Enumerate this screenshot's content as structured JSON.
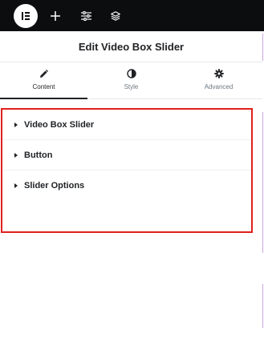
{
  "toolbar": {
    "logo_icon": "elementor-logo-icon",
    "buttons": [
      {
        "name": "add-element-button",
        "icon": "plus-icon"
      },
      {
        "name": "site-settings-button",
        "icon": "sliders-icon"
      },
      {
        "name": "structure-button",
        "icon": "layers-icon"
      }
    ]
  },
  "header": {
    "title": "Edit Video Box Slider"
  },
  "tabs": [
    {
      "label": "Content",
      "icon": "pencil-icon",
      "active": true
    },
    {
      "label": "Style",
      "icon": "half-circle-icon",
      "active": false
    },
    {
      "label": "Advanced",
      "icon": "gear-icon",
      "active": false
    }
  ],
  "sections": [
    {
      "title": "Video Box Slider",
      "icon": "caret-right-icon"
    },
    {
      "title": "Button",
      "icon": "caret-right-icon"
    },
    {
      "title": "Slider Options",
      "icon": "caret-right-icon"
    }
  ],
  "colors": {
    "toolbar_bg": "#0c0d0e",
    "highlight_border": "#e0201c",
    "text": "#1f2124",
    "muted": "#6d7882",
    "divider_accent": "#c9a7e0"
  }
}
